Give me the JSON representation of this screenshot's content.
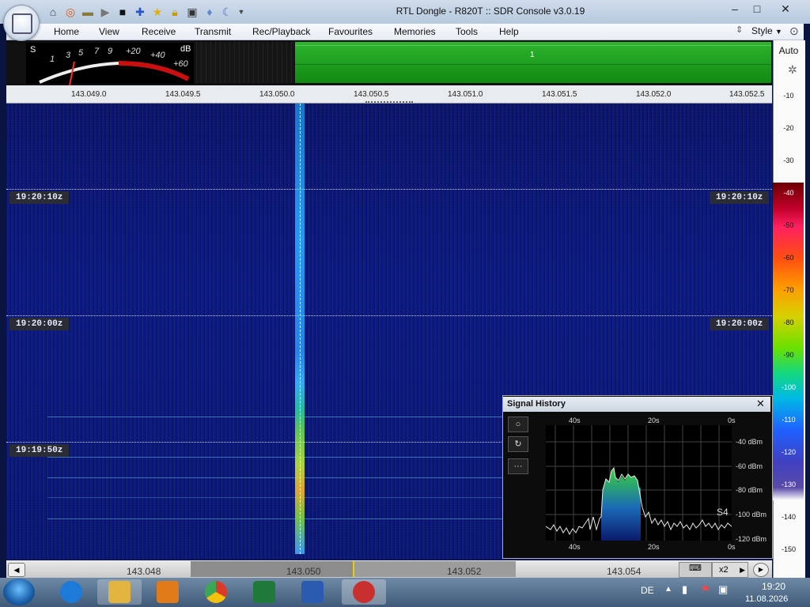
{
  "window": {
    "title": "RTL Dongle - R820T :: SDR Console v3.0.19",
    "buttons": [
      "minimize",
      "maximize",
      "close"
    ]
  },
  "quick_access_icons": [
    "home-icon",
    "lifebuoy-icon",
    "folder-icon",
    "play-icon",
    "stop-icon",
    "plus-icon",
    "star-icon",
    "lock-icon",
    "camera-icon",
    "drop-icon",
    "moon-icon",
    "dropdown-icon"
  ],
  "menu": {
    "items": [
      "Home",
      "View",
      "Receive",
      "Transmit",
      "Rec/Playback",
      "Favourites",
      "Memories",
      "Tools",
      "Help"
    ],
    "style_label": "Style"
  },
  "smeter": {
    "s_label": "S",
    "db_label": "dB",
    "scale": [
      "1",
      "3",
      "5",
      "7",
      "9",
      "+20",
      "+40",
      "+60"
    ]
  },
  "spectrum": {
    "marker": "1"
  },
  "frequency_ruler": {
    "ticks": [
      "143.049.0",
      "143.049.5",
      "143.050.0",
      "143.050.5",
      "143.051.0",
      "143.051.5",
      "143.052.0",
      "143.052.5"
    ]
  },
  "waterfall": {
    "time_markers": [
      {
        "left": "19:20:10z",
        "right": "19:20:10z"
      },
      {
        "left": "19:20:00z",
        "right": "19:20:00z"
      },
      {
        "left": "19:19:50z"
      }
    ]
  },
  "level_scale": {
    "auto_label": "Auto",
    "values": [
      "-10",
      "-20",
      "-30",
      "-40",
      "-50",
      "-60",
      "-70",
      "-80",
      "-90",
      "-100",
      "-110",
      "-120",
      "-130",
      "-140",
      "-150"
    ]
  },
  "signal_history": {
    "title": "Signal History",
    "buttons": [
      "○",
      "↻",
      "···"
    ],
    "top_axis": [
      "40s",
      "20s",
      "0s"
    ],
    "bottom_axis": [
      "40s",
      "20s",
      "0s"
    ],
    "y_axis": [
      "-40 dBm",
      "-60 dBm",
      "-80 dBm",
      "-100 dBm",
      "-120 dBm"
    ],
    "s_value": "S4"
  },
  "bottom_ruler": {
    "ticks": [
      "143.048",
      "143.050",
      "143.052",
      "143.054"
    ],
    "zoom": "x2"
  },
  "taskbar": {
    "apps": [
      "internet-explorer",
      "file-explorer",
      "media-player",
      "chrome",
      "excel",
      "word",
      "sdr-console"
    ],
    "language": "DE",
    "time": "19:20",
    "date": "11.08.2026"
  }
}
